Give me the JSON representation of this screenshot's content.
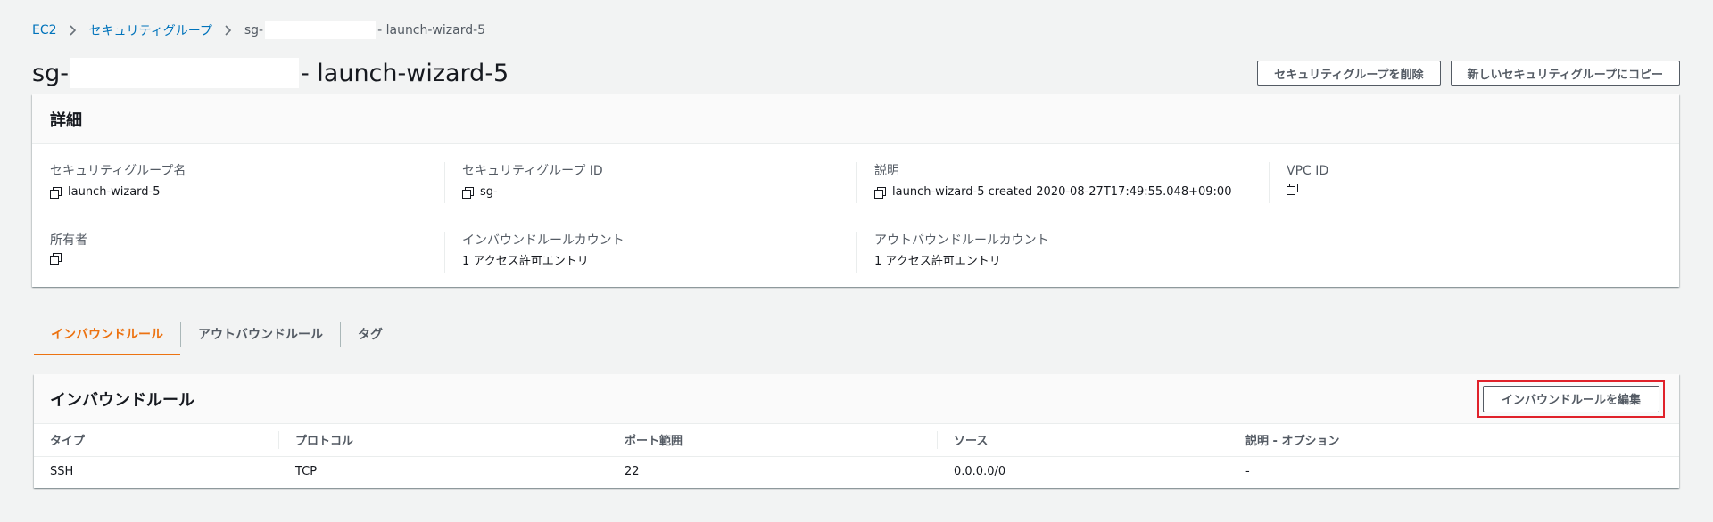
{
  "breadcrumb": {
    "root": "EC2",
    "section": "セキュリティグループ",
    "current_prefix": "sg-",
    "current_suffix": " - launch-wizard-5"
  },
  "title": {
    "prefix": "sg-",
    "suffix": " - launch-wizard-5"
  },
  "actions": {
    "delete_label": "セキュリティグループを削除",
    "copy_label": "新しいセキュリティグループにコピー"
  },
  "details": {
    "header": "詳細",
    "fields": [
      {
        "label": "セキュリティグループ名",
        "value": "launch-wizard-5",
        "copy": true
      },
      {
        "label": "セキュリティグループ ID",
        "value": "sg-",
        "copy": true
      },
      {
        "label": "説明",
        "value": "launch-wizard-5 created 2020-08-27T17:49:55.048+09:00",
        "copy": true
      },
      {
        "label": "VPC ID",
        "value": "",
        "copy": true
      },
      {
        "label": "所有者",
        "value": "",
        "copy": true
      },
      {
        "label": "インバウンドルールカウント",
        "value": "1 アクセス許可エントリ",
        "copy": false
      },
      {
        "label": "アウトバウンドルールカウント",
        "value": "1 アクセス許可エントリ",
        "copy": false
      }
    ]
  },
  "tabs": [
    {
      "label": "インバウンドルール",
      "active": true
    },
    {
      "label": "アウトバウンドルール",
      "active": false
    },
    {
      "label": "タグ",
      "active": false
    }
  ],
  "inbound_rules": {
    "title": "インバウンドルール",
    "edit_label": "インバウンドルールを編集",
    "columns": [
      "タイプ",
      "プロトコル",
      "ポート範囲",
      "ソース",
      "説明 - オプション"
    ],
    "rows": [
      [
        "SSH",
        "TCP",
        "22",
        "0.0.0.0/0",
        "-"
      ]
    ]
  },
  "colors": {
    "link": "#0073bb",
    "active_tab": "#ec7211",
    "highlight": "#e0222b"
  },
  "icons": [
    "chevron-right-icon",
    "copy-icon"
  ]
}
